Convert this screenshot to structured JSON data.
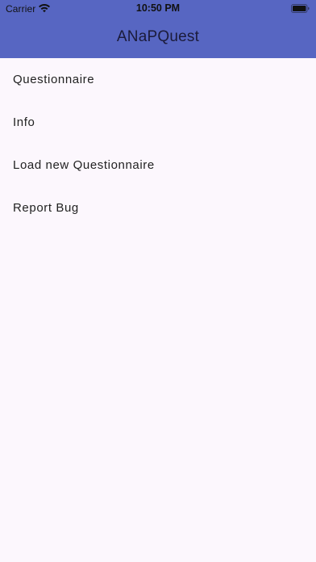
{
  "status_bar": {
    "carrier": "Carrier",
    "time": "10:50 PM",
    "wifi_icon": "wifi-icon",
    "battery_icon": "battery-icon"
  },
  "app_bar": {
    "title": "ANaPQuest",
    "color": "#5766c2"
  },
  "menu": {
    "items": [
      {
        "label": "Questionnaire"
      },
      {
        "label": "Info"
      },
      {
        "label": "Load new Questionnaire"
      },
      {
        "label": "Report Bug"
      }
    ]
  },
  "colors": {
    "background": "#fcf7fd",
    "text": "#222222"
  }
}
